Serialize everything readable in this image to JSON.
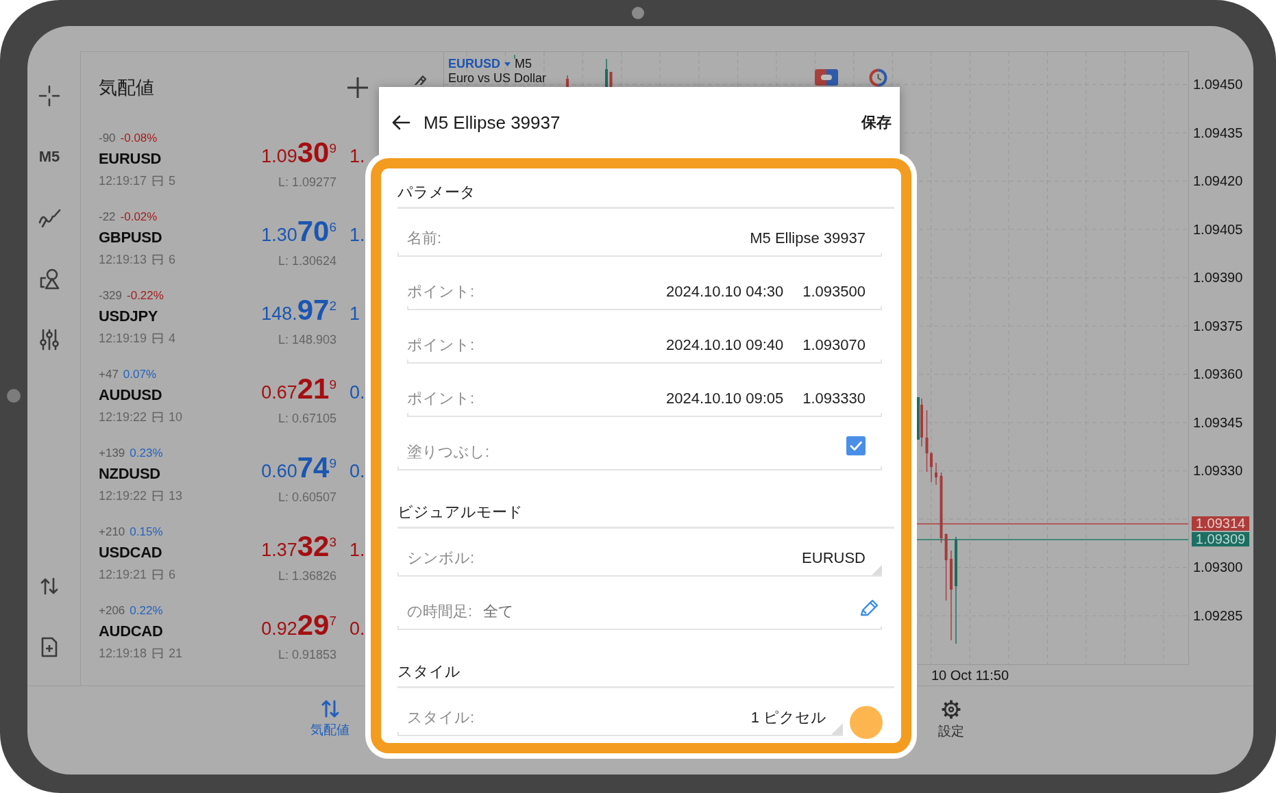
{
  "toolbar": {
    "timeframe": "M5"
  },
  "market_watch": {
    "title": "気配値",
    "quotes": [
      {
        "change_points": "-90",
        "change_percent": "-0.08%",
        "change_down": true,
        "symbol": "EURUSD",
        "time": "12:19:17",
        "spread": "5",
        "bid": {
          "head": "1.09",
          "big": "30",
          "sup": "9",
          "down": true
        },
        "low": "L: 1.09277",
        "ask": {
          "text": "1.",
          "down": true
        }
      },
      {
        "change_points": "-22",
        "change_percent": "-0.02%",
        "change_down": true,
        "symbol": "GBPUSD",
        "time": "12:19:13",
        "spread": "6",
        "bid": {
          "head": "1.30",
          "big": "70",
          "sup": "6",
          "down": false
        },
        "low": "L: 1.30624",
        "ask": {
          "text": "1.",
          "down": false
        }
      },
      {
        "change_points": "-329",
        "change_percent": "-0.22%",
        "change_down": true,
        "symbol": "USDJPY",
        "time": "12:19:19",
        "spread": "4",
        "bid": {
          "head": "148.",
          "big": "97",
          "sup": "2",
          "down": false
        },
        "low": "L: 148.903",
        "ask": {
          "text": "1",
          "down": false
        }
      },
      {
        "change_points": "+47",
        "change_percent": "0.07%",
        "change_down": false,
        "symbol": "AUDUSD",
        "time": "12:19:22",
        "spread": "10",
        "bid": {
          "head": "0.67",
          "big": "21",
          "sup": "9",
          "down": true
        },
        "low": "L: 0.67105",
        "ask": {
          "text": "0.",
          "down": false
        }
      },
      {
        "change_points": "+139",
        "change_percent": "0.23%",
        "change_down": false,
        "symbol": "NZDUSD",
        "time": "12:19:22",
        "spread": "13",
        "bid": {
          "head": "0.60",
          "big": "74",
          "sup": "9",
          "down": false
        },
        "low": "L: 0.60507",
        "ask": {
          "text": "0.",
          "down": false
        }
      },
      {
        "change_points": "+210",
        "change_percent": "0.15%",
        "change_down": false,
        "symbol": "USDCAD",
        "time": "12:19:21",
        "spread": "6",
        "bid": {
          "head": "1.37",
          "big": "32",
          "sup": "3",
          "down": true
        },
        "low": "L: 1.36826",
        "ask": {
          "text": "1.",
          "down": true
        }
      },
      {
        "change_points": "+206",
        "change_percent": "0.22%",
        "change_down": false,
        "symbol": "AUDCAD",
        "time": "12:19:18",
        "spread": "21",
        "bid": {
          "head": "0.92",
          "big": "29",
          "sup": "7",
          "down": true
        },
        "low": "L: 0.91853",
        "ask": {
          "text": "0.",
          "down": true
        }
      }
    ]
  },
  "chart": {
    "symbol": "EURUSD",
    "timeframe": "M5",
    "description": "Euro vs US Dollar",
    "price_labels_above": [
      "1.09450",
      "1.09435",
      "1.09420",
      "1.09405",
      "1.09390",
      "1.09375",
      "1.09360",
      "1.09345",
      "1.09330"
    ],
    "bid_tag": "1.09314",
    "ask_tag": "1.09309",
    "price_labels_below": [
      "1.09300",
      "1.09285"
    ],
    "time_label": "10 Oct 11:50"
  },
  "dialog": {
    "title": "M5 Ellipse 39937",
    "save": "保存",
    "sections": [
      {
        "title": "パラメータ",
        "rows": [
          {
            "kind": "text",
            "label": "名前:",
            "value": "M5 Ellipse 39937"
          },
          {
            "kind": "point",
            "label": "ポイント:",
            "date": "2024.10.10 04:30",
            "price": "1.093500"
          },
          {
            "kind": "point",
            "label": "ポイント:",
            "date": "2024.10.10 09:40",
            "price": "1.093070"
          },
          {
            "kind": "point",
            "label": "ポイント:",
            "date": "2024.10.10 09:05",
            "price": "1.093330"
          },
          {
            "kind": "checkbox",
            "label": "塗りつぶし:",
            "checked": true
          }
        ]
      },
      {
        "title": "ビジュアルモード",
        "rows": [
          {
            "kind": "dropdown",
            "label": "シンボル:",
            "value": "EURUSD"
          },
          {
            "kind": "edit",
            "label": "の時間足:",
            "value": "全て"
          }
        ]
      },
      {
        "title": "スタイル",
        "rows": [
          {
            "kind": "style",
            "label": "スタイル:",
            "value": "1 ピクセル",
            "color": "#fdb64f"
          }
        ]
      }
    ]
  },
  "bottom_nav": {
    "tabs": [
      {
        "kind": "quotes",
        "label": "気配値",
        "selected": true
      },
      {
        "kind": "settings",
        "label": "設定",
        "selected": false
      }
    ]
  }
}
